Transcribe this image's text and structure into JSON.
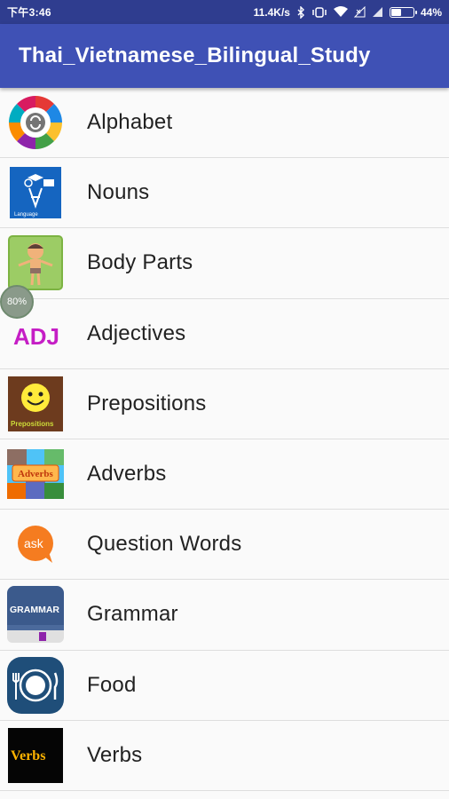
{
  "status_bar": {
    "time": "下午3:46",
    "net_speed": "11.4K/s",
    "battery": "44%",
    "battery_level": 0.44
  },
  "app": {
    "title": "Thai_Vietnamese_Bilingual_Study"
  },
  "overlay": {
    "badge": "80%"
  },
  "items": [
    {
      "label": "Alphabet",
      "icon": "alphabet-wheel-icon"
    },
    {
      "label": "Nouns",
      "icon": "nouns-language-icon",
      "icon_text": "Language"
    },
    {
      "label": "Body Parts",
      "icon": "body-parts-boy-icon"
    },
    {
      "label": "Adjectives",
      "icon": "adjectives-adj-icon",
      "icon_text": "ADJ"
    },
    {
      "label": "Prepositions",
      "icon": "prepositions-smiley-icon",
      "icon_text": "Prepositions"
    },
    {
      "label": "Adverbs",
      "icon": "adverbs-collage-icon",
      "icon_text": "Adverbs"
    },
    {
      "label": "Question Words",
      "icon": "ask-bubble-icon",
      "icon_text": "ask"
    },
    {
      "label": "Grammar",
      "icon": "grammar-book-icon",
      "icon_text": "GRAMMAR"
    },
    {
      "label": "Food",
      "icon": "food-plate-icon"
    },
    {
      "label": "Verbs",
      "icon": "verbs-icon",
      "icon_text": "Verbs"
    }
  ]
}
